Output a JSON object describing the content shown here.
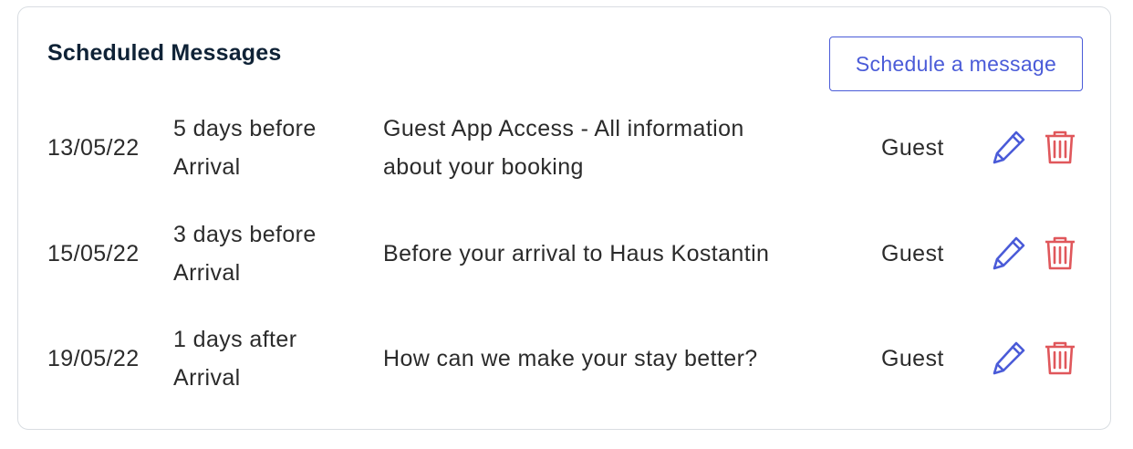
{
  "panel": {
    "title": "Scheduled Messages",
    "schedule_button_label": "Schedule a message"
  },
  "messages": [
    {
      "date": "13/05/22",
      "timing_line1": "5 days before",
      "timing_line2": "Arrival",
      "subject_line1": "Guest App Access - All information",
      "subject_line2": "about your booking",
      "recipient": "Guest"
    },
    {
      "date": "15/05/22",
      "timing_line1": "3 days before",
      "timing_line2": "Arrival",
      "subject_line1": "Before your arrival to Haus Kostantin",
      "subject_line2": "",
      "recipient": "Guest"
    },
    {
      "date": "19/05/22",
      "timing_line1": "1 days after",
      "timing_line2": "Arrival",
      "subject_line1": "How can we make your stay better?",
      "subject_line2": "",
      "recipient": "Guest"
    }
  ],
  "icons": {
    "edit": "pencil-icon",
    "delete": "trash-icon"
  },
  "colors": {
    "accent": "#4a5bd8",
    "danger": "#e0575b",
    "title": "#0f2236",
    "text": "#2b2b2b",
    "border": "#d9dde2"
  }
}
